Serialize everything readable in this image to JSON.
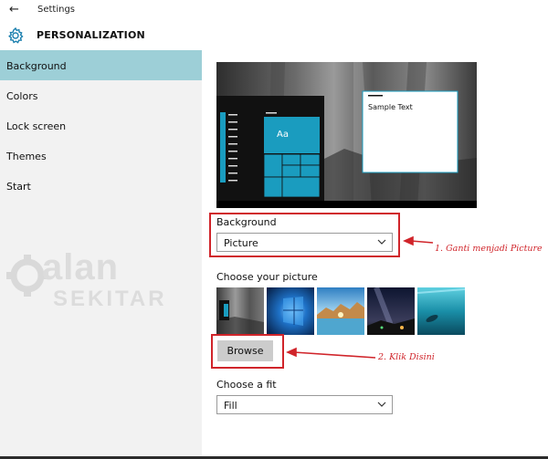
{
  "window": {
    "title": "Settings"
  },
  "header": {
    "title": "PERSONALIZATION"
  },
  "sidebar": {
    "items": [
      {
        "label": "Background",
        "active": true
      },
      {
        "label": "Colors",
        "active": false
      },
      {
        "label": "Lock screen",
        "active": false
      },
      {
        "label": "Themes",
        "active": false
      },
      {
        "label": "Start",
        "active": false
      }
    ]
  },
  "watermark": {
    "line1": "JalanSEKITAR"
  },
  "preview": {
    "sample_text": "Sample Text",
    "tile_label": "Aa"
  },
  "background": {
    "label": "Background",
    "value": "Picture"
  },
  "choose_picture": {
    "label": "Choose your picture",
    "browse_label": "Browse"
  },
  "choose_fit": {
    "label": "Choose a fit",
    "value": "Fill"
  },
  "annotations": {
    "step1": "1. Ganti menjadi Picture",
    "step2": "2. Klik Disini"
  },
  "colors": {
    "accent": "#9dcfd7",
    "tile": "#1a9cbf",
    "annotation": "#d0242a"
  }
}
